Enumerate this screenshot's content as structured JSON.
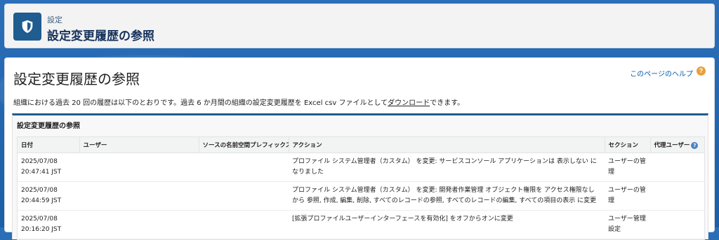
{
  "header": {
    "eyebrow": "設定",
    "title": "設定変更履歴の参照",
    "icon": "shield-icon"
  },
  "page": {
    "title": "設定変更履歴の参照",
    "help_link": "このページのヘルプ",
    "help_icon_glyph": "?",
    "description_before": "組織における過去 20 回の履歴は以下のとおりです。過去 6 か月間の組織の設定変更履歴を Excel csv ファイルとして",
    "download_link": "ダウンロード",
    "description_after": "できます。"
  },
  "history": {
    "section_title": "設定変更履歴の参照",
    "columns": {
      "date": "日付",
      "user": "ユーザー",
      "namespace": "ソースの名前空間プレフィックス",
      "action": "アクション",
      "section": "セクション",
      "delegate": "代理ユーザー"
    },
    "rows": [
      {
        "date": "2025/07/08",
        "time": "20:47:41 JST",
        "user": "",
        "namespace": "",
        "action": "プロファイル システム管理者（カスタム） を変更: サービスコンソール アプリケーションは 表示しない になりました",
        "section": "ユーザーの管理",
        "delegate": ""
      },
      {
        "date": "2025/07/08",
        "time": "20:44:59 JST",
        "user": "",
        "namespace": "",
        "action": "プロファイル システム管理者（カスタム） を変更: 開発者作業管理 オブジェクト権限を アクセス権限なし から 参照, 作成, 編集, 削除, すべてのレコードの参照, すべてのレコードの編集, すべての項目の表示 に変更",
        "section": "ユーザーの管理",
        "delegate": ""
      },
      {
        "date": "2025/07/08",
        "time": "20:16:20 JST",
        "user": "",
        "namespace": "",
        "action": "[拡張プロファイルユーザーインターフェースを有効化] をオフからオンに変更",
        "section": "ユーザー管理設定",
        "delegate": ""
      }
    ]
  }
}
